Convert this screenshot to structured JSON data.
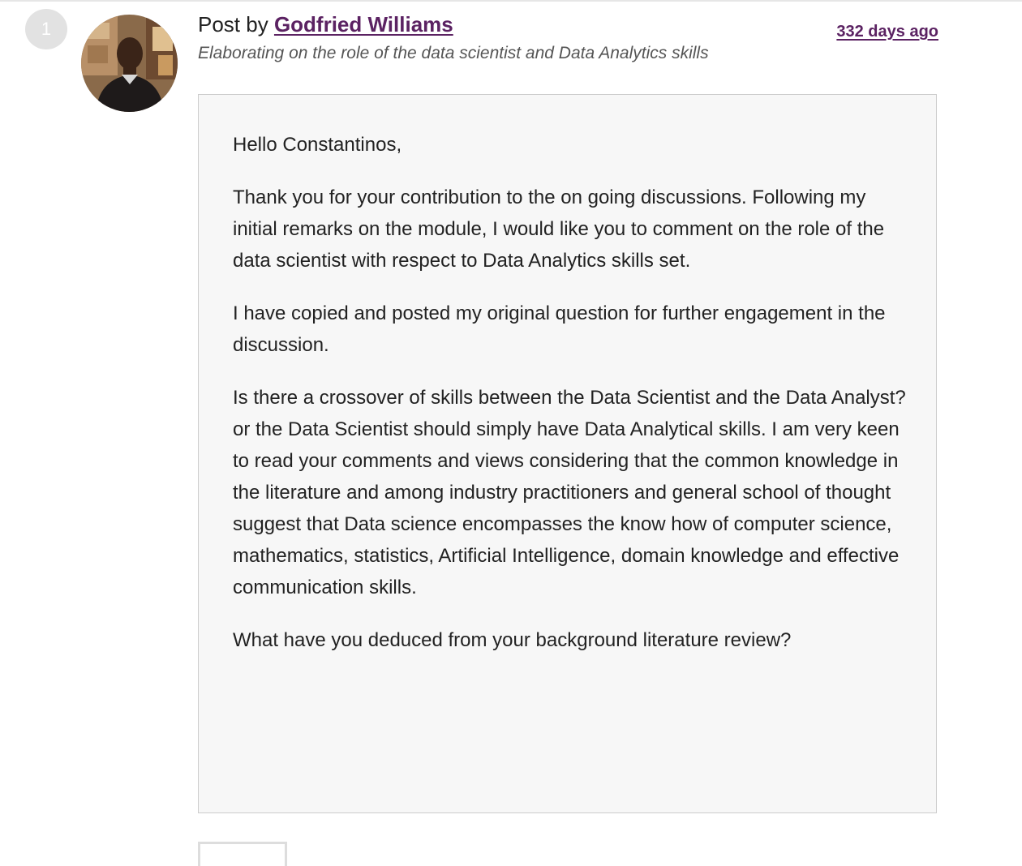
{
  "post": {
    "number": "1",
    "prefix": "Post by ",
    "author": "Godfried Williams",
    "subject": "Elaborating on the role of the data scientist and Data Analytics skills",
    "time_ago": "332 days ago"
  },
  "message": {
    "paragraphs": [
      "Hello Constantinos,",
      "Thank you for your contribution to the on going discussions. Following my initial remarks on the module, I would like you to comment on the role of the data scientist with respect to Data Analytics skills set.",
      "I have copied and posted my original question for further engagement in the discussion.",
      "Is there a crossover of skills between the Data Scientist and the Data Analyst? or the Data Scientist should simply have Data Analytical skills.  I am very keen to read your comments and views considering that the common knowledge in the literature and among industry practitioners and general school of thought suggest that Data science encompasses the know how of computer science, mathematics, statistics, Artificial Intelligence, domain knowledge and effective communication skills.",
      "What have you deduced from your background literature review?"
    ]
  },
  "colors": {
    "link": "#5b2262",
    "box_background": "#f7f7f7",
    "box_border": "#cccccc",
    "number_badge": "#e2e2e2"
  },
  "icons": {
    "avatar": "user-photo"
  }
}
